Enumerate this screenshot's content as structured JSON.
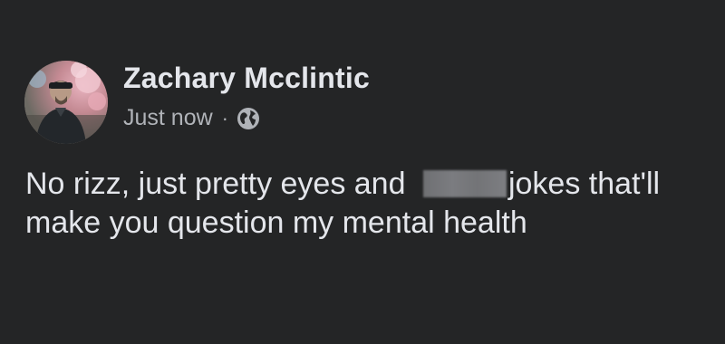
{
  "post": {
    "author_name": "Zachary Mcclintic",
    "timestamp": "Just now",
    "separator": "·",
    "audience_icon": "globe-icon",
    "text_before_redaction": "No rizz, just pretty eyes and ",
    "text_after_redaction": "jokes that'll make you question my mental health",
    "avatar_icon": "profile-photo"
  },
  "colors": {
    "background": "#242526",
    "primary_text": "#e4e6eb",
    "secondary_text": "#b0b3b8"
  }
}
